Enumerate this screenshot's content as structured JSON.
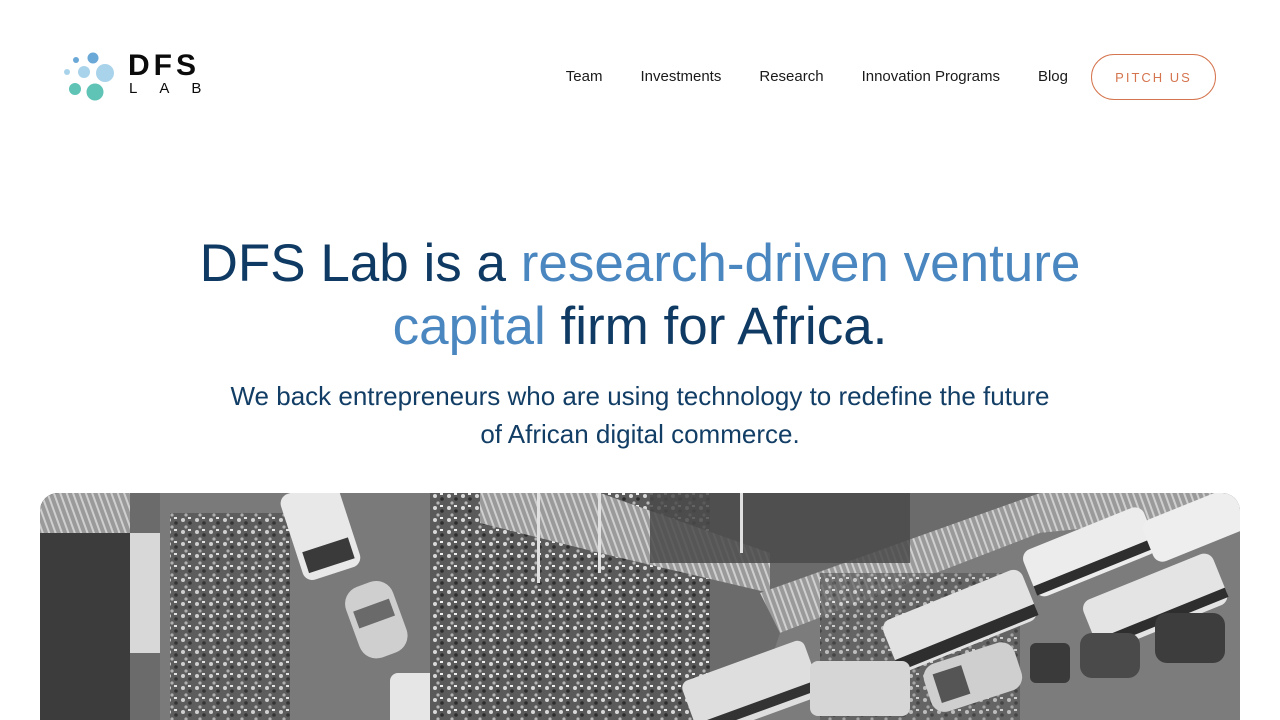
{
  "header": {
    "logo": {
      "text": "DFS",
      "subtext": "LAB",
      "colors": [
        "#6aa8d8",
        "#a9d3ea",
        "#5fc3b6"
      ]
    },
    "nav": [
      {
        "label": "Team"
      },
      {
        "label": "Investments"
      },
      {
        "label": "Research"
      },
      {
        "label": "Innovation Programs"
      },
      {
        "label": "Blog"
      }
    ],
    "cta_label": "PITCH US"
  },
  "hero": {
    "title_part1": "DFS Lab is a ",
    "title_highlight": "research-driven venture capital",
    "title_part2": " firm for Africa.",
    "subtitle": "We back entrepreneurs who are using technology to redefine the future of African digital commerce."
  },
  "colors": {
    "title": "#0f3a63",
    "highlight": "#4a86bf",
    "cta": "#d5754f"
  },
  "image": {
    "icon": "market-street-photo"
  }
}
